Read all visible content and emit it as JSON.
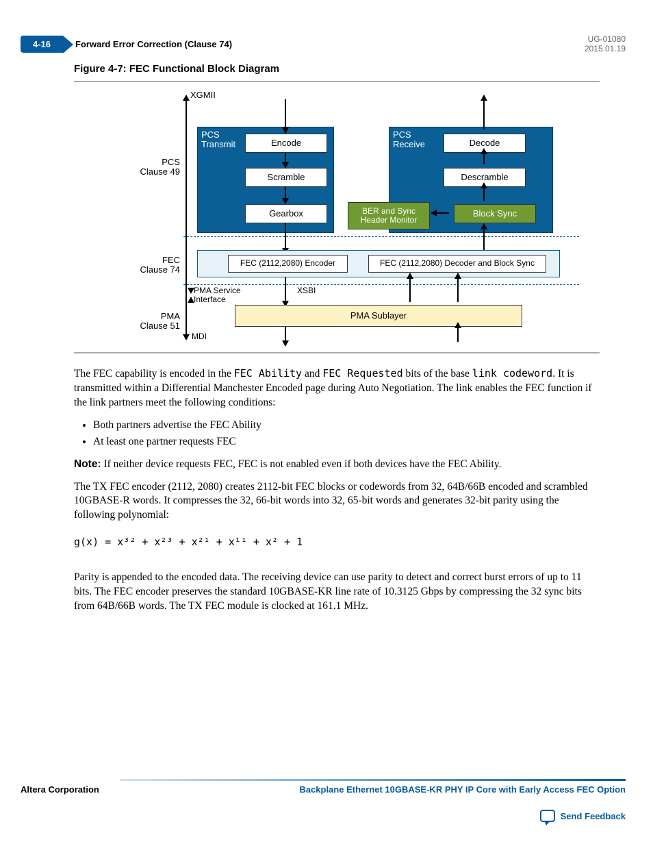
{
  "header": {
    "page_num": "4-16",
    "section": "Forward Error Correction (Clause 74)",
    "doc_id": "UG-01080",
    "date": "2015.01.19"
  },
  "figure": {
    "title": "Figure 4-7: FEC Functional Block Diagram",
    "labels": {
      "xgmii": "XGMII",
      "pcs_transmit": "PCS Transmit",
      "pcs_receive": "PCS Receive",
      "encode": "Encode",
      "decode": "Decode",
      "scramble": "Scramble",
      "descramble": "Descramble",
      "gearbox": "Gearbox",
      "ber_sync": "BER and Sync Header Monitor",
      "block_sync": "Block Sync",
      "fec_encoder": "FEC (2112,2080) Encoder",
      "fec_decoder": "FEC (2112,2080) Decoder and Block Sync",
      "pma_service": "PMA Service Interface",
      "xsbi": "XSBI",
      "pma_sublayer": "PMA Sublayer",
      "mdi": "MDI",
      "left_pcs": "PCS Clause 49",
      "left_fec": "FEC Clause 74",
      "left_pma": "PMA Clause 51"
    }
  },
  "para1_a": "The FEC capability is encoded in the ",
  "para1_b": " and ",
  "para1_c": " bits of the base ",
  "para1_d": ". It is transmitted within a Differential Manchester Encoded page during Auto Negotiation. The link enables the FEC function if the link partners meet the following conditions:",
  "code1": "FEC Ability",
  "code2": "FEC Requested",
  "code3": "link codeword",
  "bullets": [
    "Both partners advertise the FEC Ability",
    "At least one partner requests FEC"
  ],
  "note_label": "Note:",
  "note_text": " If neither device requests FEC, FEC is not enabled even if both devices have the FEC Ability.",
  "para2": "The TX FEC encoder (2112, 2080) creates 2112-bit FEC blocks or codewords from 32, 64B/66B encoded and scrambled 10GBASE-R words. It compresses the 32, 66-bit words into 32, 65-bit words and generates 32-bit parity using the following polynomial:",
  "poly": "g(x) = x³² + x²³ + x²¹ + x¹¹ + x² + 1",
  "para3": "Parity is appended to the encoded data. The receiving device can use parity to detect and correct burst errors of up to 11 bits. The FEC encoder preserves the standard 10GBASE-KR line rate of 10.3125 Gbps by compressing the 32 sync bits from 64B/66B words. The TX FEC module is clocked at 161.1 MHz.",
  "footer": {
    "company": "Altera Corporation",
    "doc_title": "Backplane Ethernet 10GBASE-KR PHY IP Core with Early Access FEC Option",
    "feedback": "Send Feedback"
  }
}
